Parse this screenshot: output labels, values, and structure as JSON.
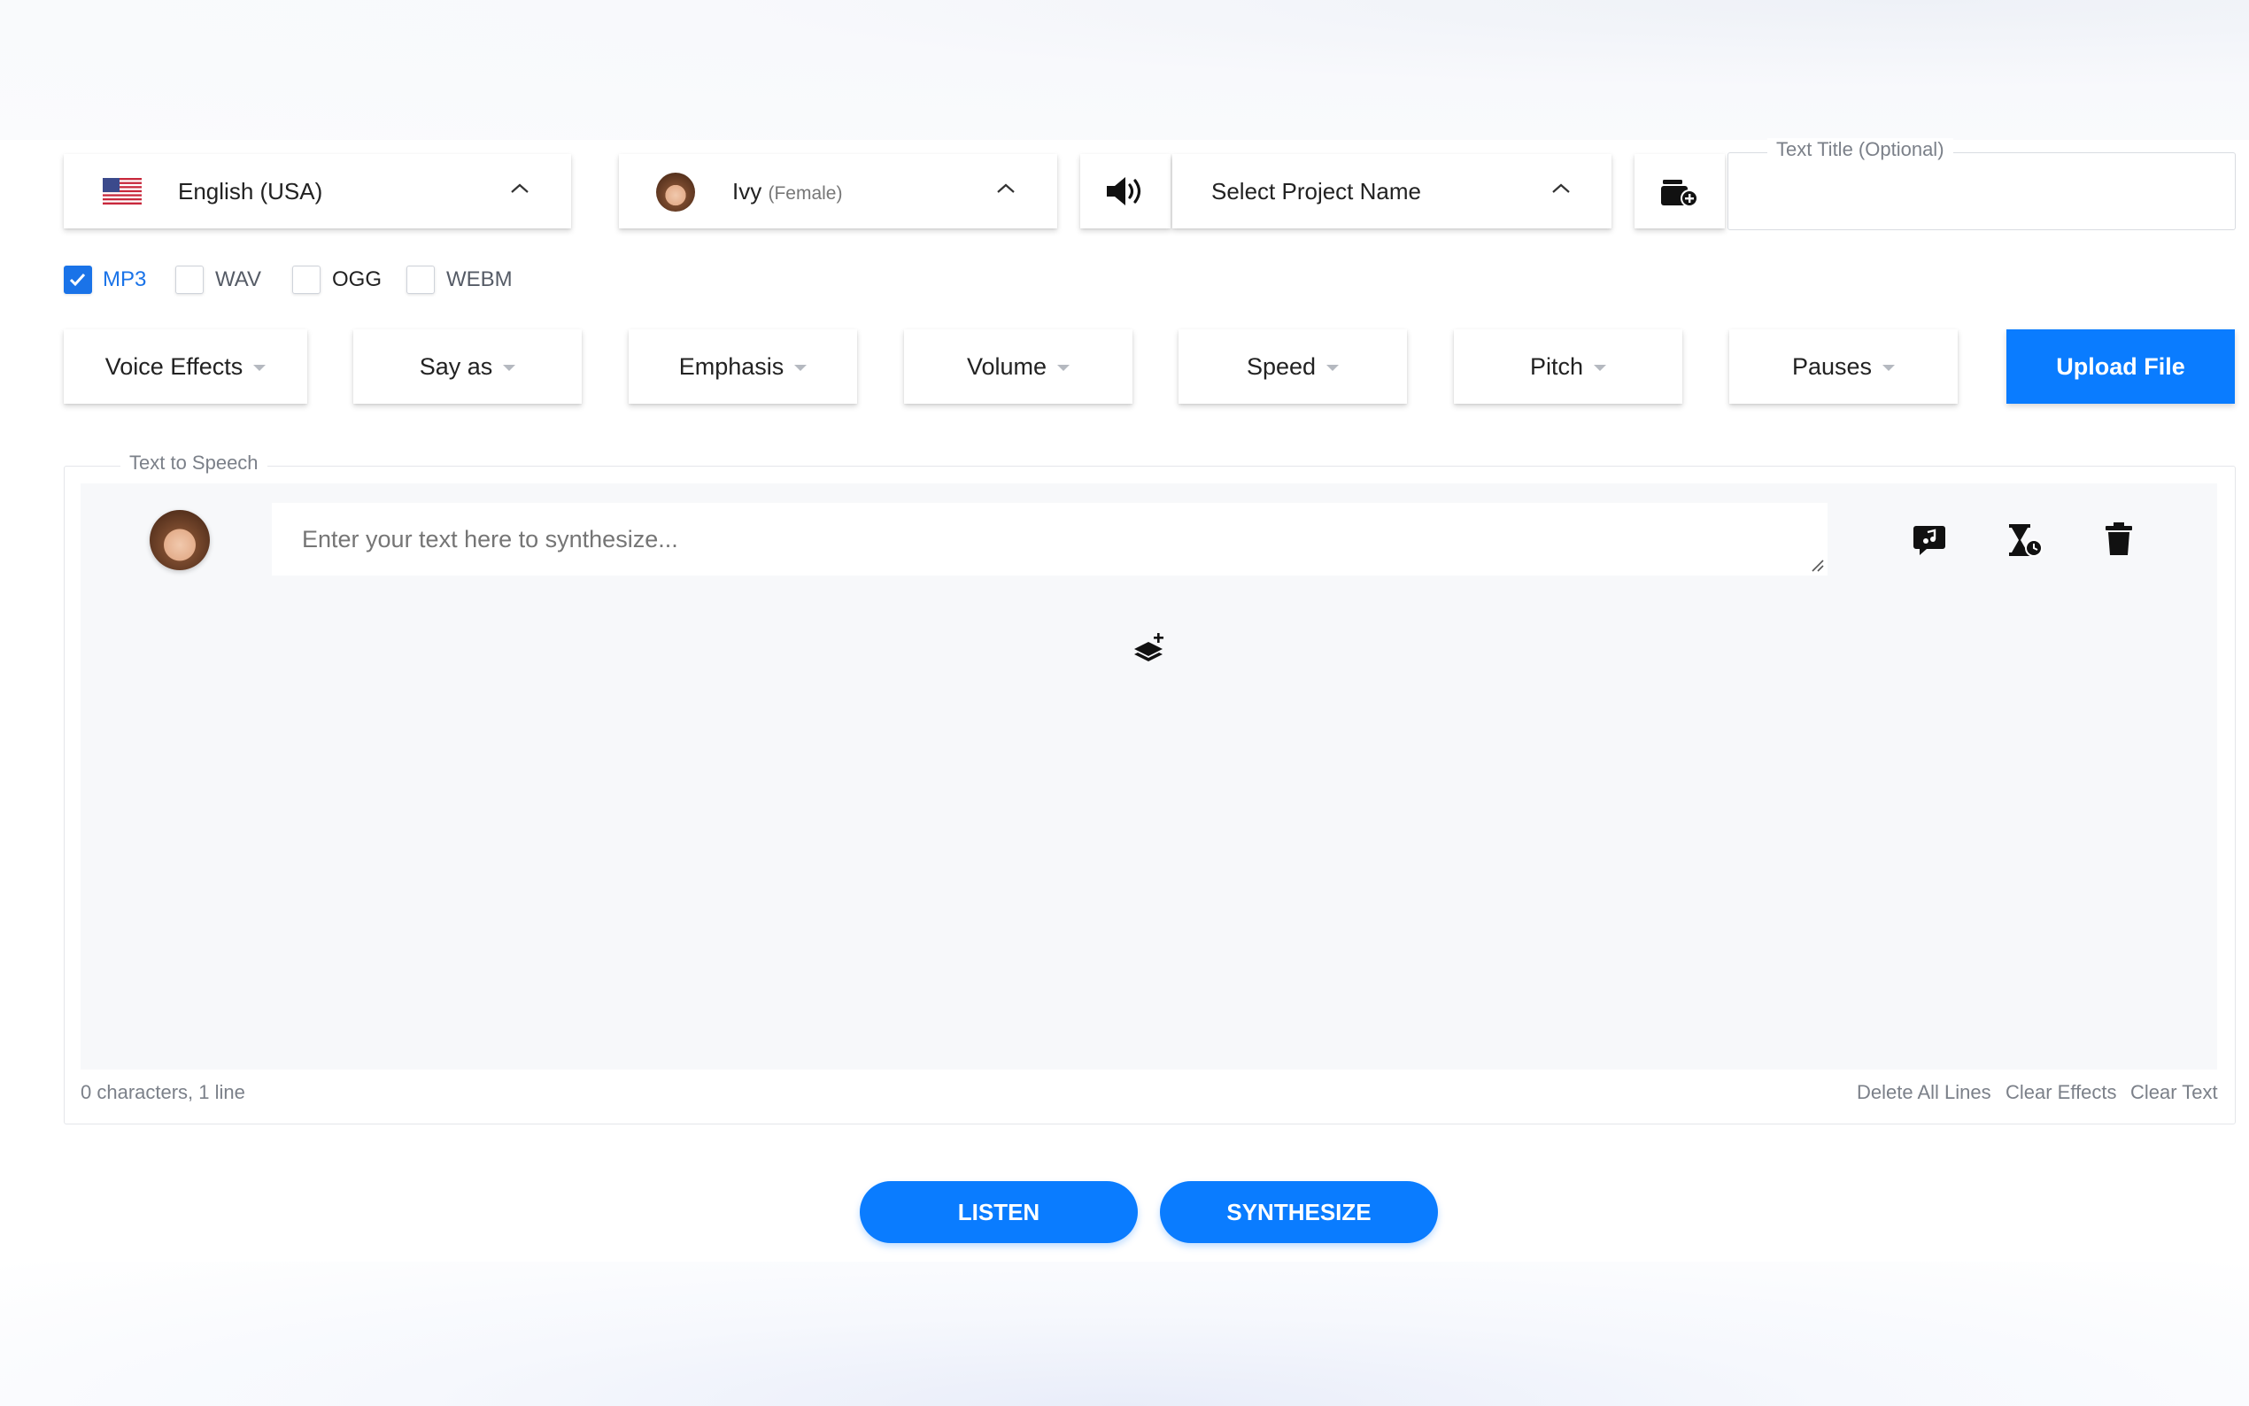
{
  "language": {
    "label": "English (USA)",
    "flag": "us-flag-icon"
  },
  "voice": {
    "name": "Ivy",
    "gender": "(Female)"
  },
  "project": {
    "label": "Select Project Name"
  },
  "text_title": {
    "legend": "Text Title (Optional)",
    "value": ""
  },
  "formats": [
    {
      "label": "MP3",
      "checked": true
    },
    {
      "label": "WAV",
      "checked": false
    },
    {
      "label": "OGG",
      "checked": false
    },
    {
      "label": "WEBM",
      "checked": false
    }
  ],
  "controls": {
    "voice_effects": "Voice Effects",
    "say_as": "Say as",
    "emphasis": "Emphasis",
    "volume": "Volume",
    "speed": "Speed",
    "pitch": "Pitch",
    "pauses": "Pauses",
    "upload": "Upload File"
  },
  "editor": {
    "legend": "Text to Speech",
    "placeholder": "Enter your text here to synthesize...",
    "counter": "0 characters, 1 line",
    "delete_all": "Delete All Lines",
    "clear_effects": "Clear Effects",
    "clear_text": "Clear Text"
  },
  "actions": {
    "listen": "LISTEN",
    "synthesize": "SYNTHESIZE"
  },
  "colors": {
    "accent": "#0a7cff",
    "editor_bg": "#f7f8fa"
  }
}
